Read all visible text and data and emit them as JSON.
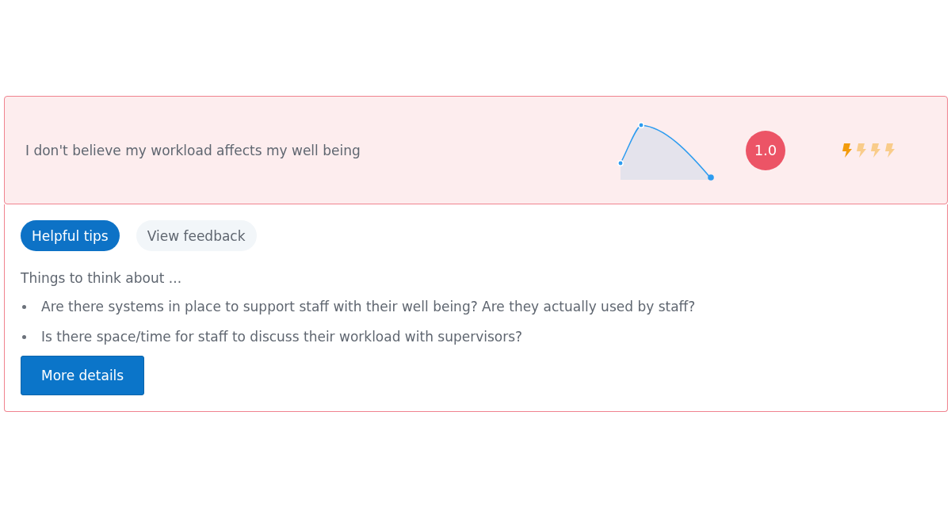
{
  "statement": {
    "text": "I don't believe my workload affects my well being",
    "score": "1.0",
    "rating": {
      "stars": 1
    }
  },
  "tabs": [
    {
      "label": "Helpful tips",
      "selected": true
    },
    {
      "label": "View feedback",
      "selected": false
    }
  ],
  "tips": {
    "heading": "Things to think about ...",
    "items": [
      "Are there systems in place to support staff with their well being? Are they actually used by staff?",
      "Is there space/time for staff to discuss their workload with supervisors?"
    ]
  },
  "button": "More details"
}
